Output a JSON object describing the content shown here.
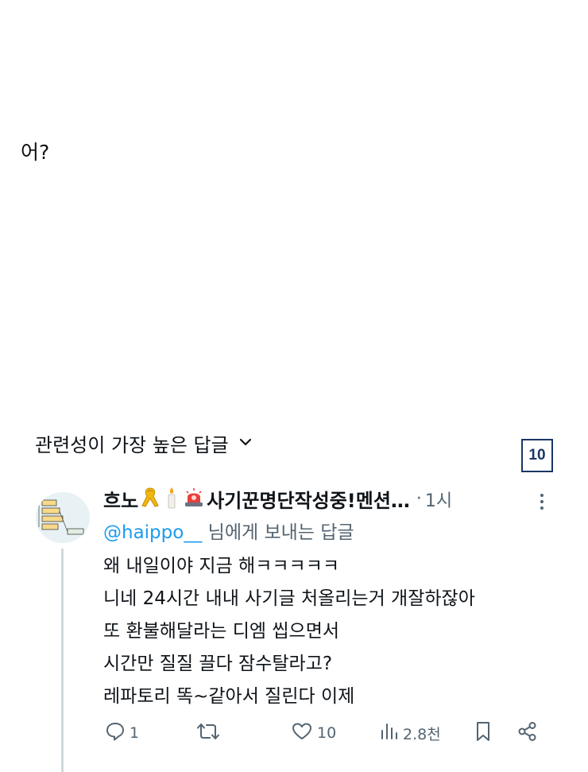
{
  "post": {
    "caption": "어?"
  },
  "replies_section": {
    "sort_label": "관련성이 가장 높은 답글"
  },
  "badge": {
    "number": "10"
  },
  "reply": {
    "display_name": "흐노",
    "display_name_tail": "사기꾼명단작성중!멘션…",
    "time_separator": "·",
    "time": "1시",
    "reply_prefix_handle": "@haippo__",
    "reply_suffix": " 님에게 보내는 답글",
    "lines": [
      "왜 내일이야 지금 해ㅋㅋㅋㅋㅋ",
      "니네 24시간 내내 사기글 처올리는거 개잘하잖아",
      "또 환불해달라는 디엠 씹으면서",
      "시간만 질질 끌다 잠수탈라고?",
      "레파토리 똑~같아서 질린다 이제"
    ],
    "icons": [
      "ribbon-icon",
      "candle-icon",
      "siren-icon"
    ],
    "actions": {
      "reply_count": "1",
      "retweet_count": "",
      "like_count": "10",
      "views_count": "2.8천"
    }
  },
  "colors": {
    "accent": "#1d9bf0",
    "muted": "#536471",
    "badge": "#1a3766"
  }
}
